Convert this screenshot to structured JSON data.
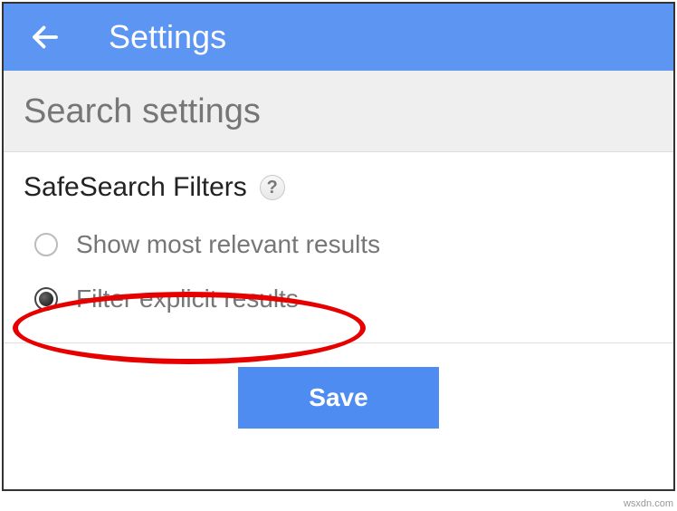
{
  "header": {
    "title": "Settings"
  },
  "subheader": {
    "title": "Search settings"
  },
  "safesearch": {
    "section_title": "SafeSearch Filters",
    "help_symbol": "?",
    "options": {
      "most_relevant": "Show most relevant results",
      "filter_explicit": "Filter explicit results"
    }
  },
  "footer": {
    "save_label": "Save"
  },
  "watermark": "wsxdn.com"
}
